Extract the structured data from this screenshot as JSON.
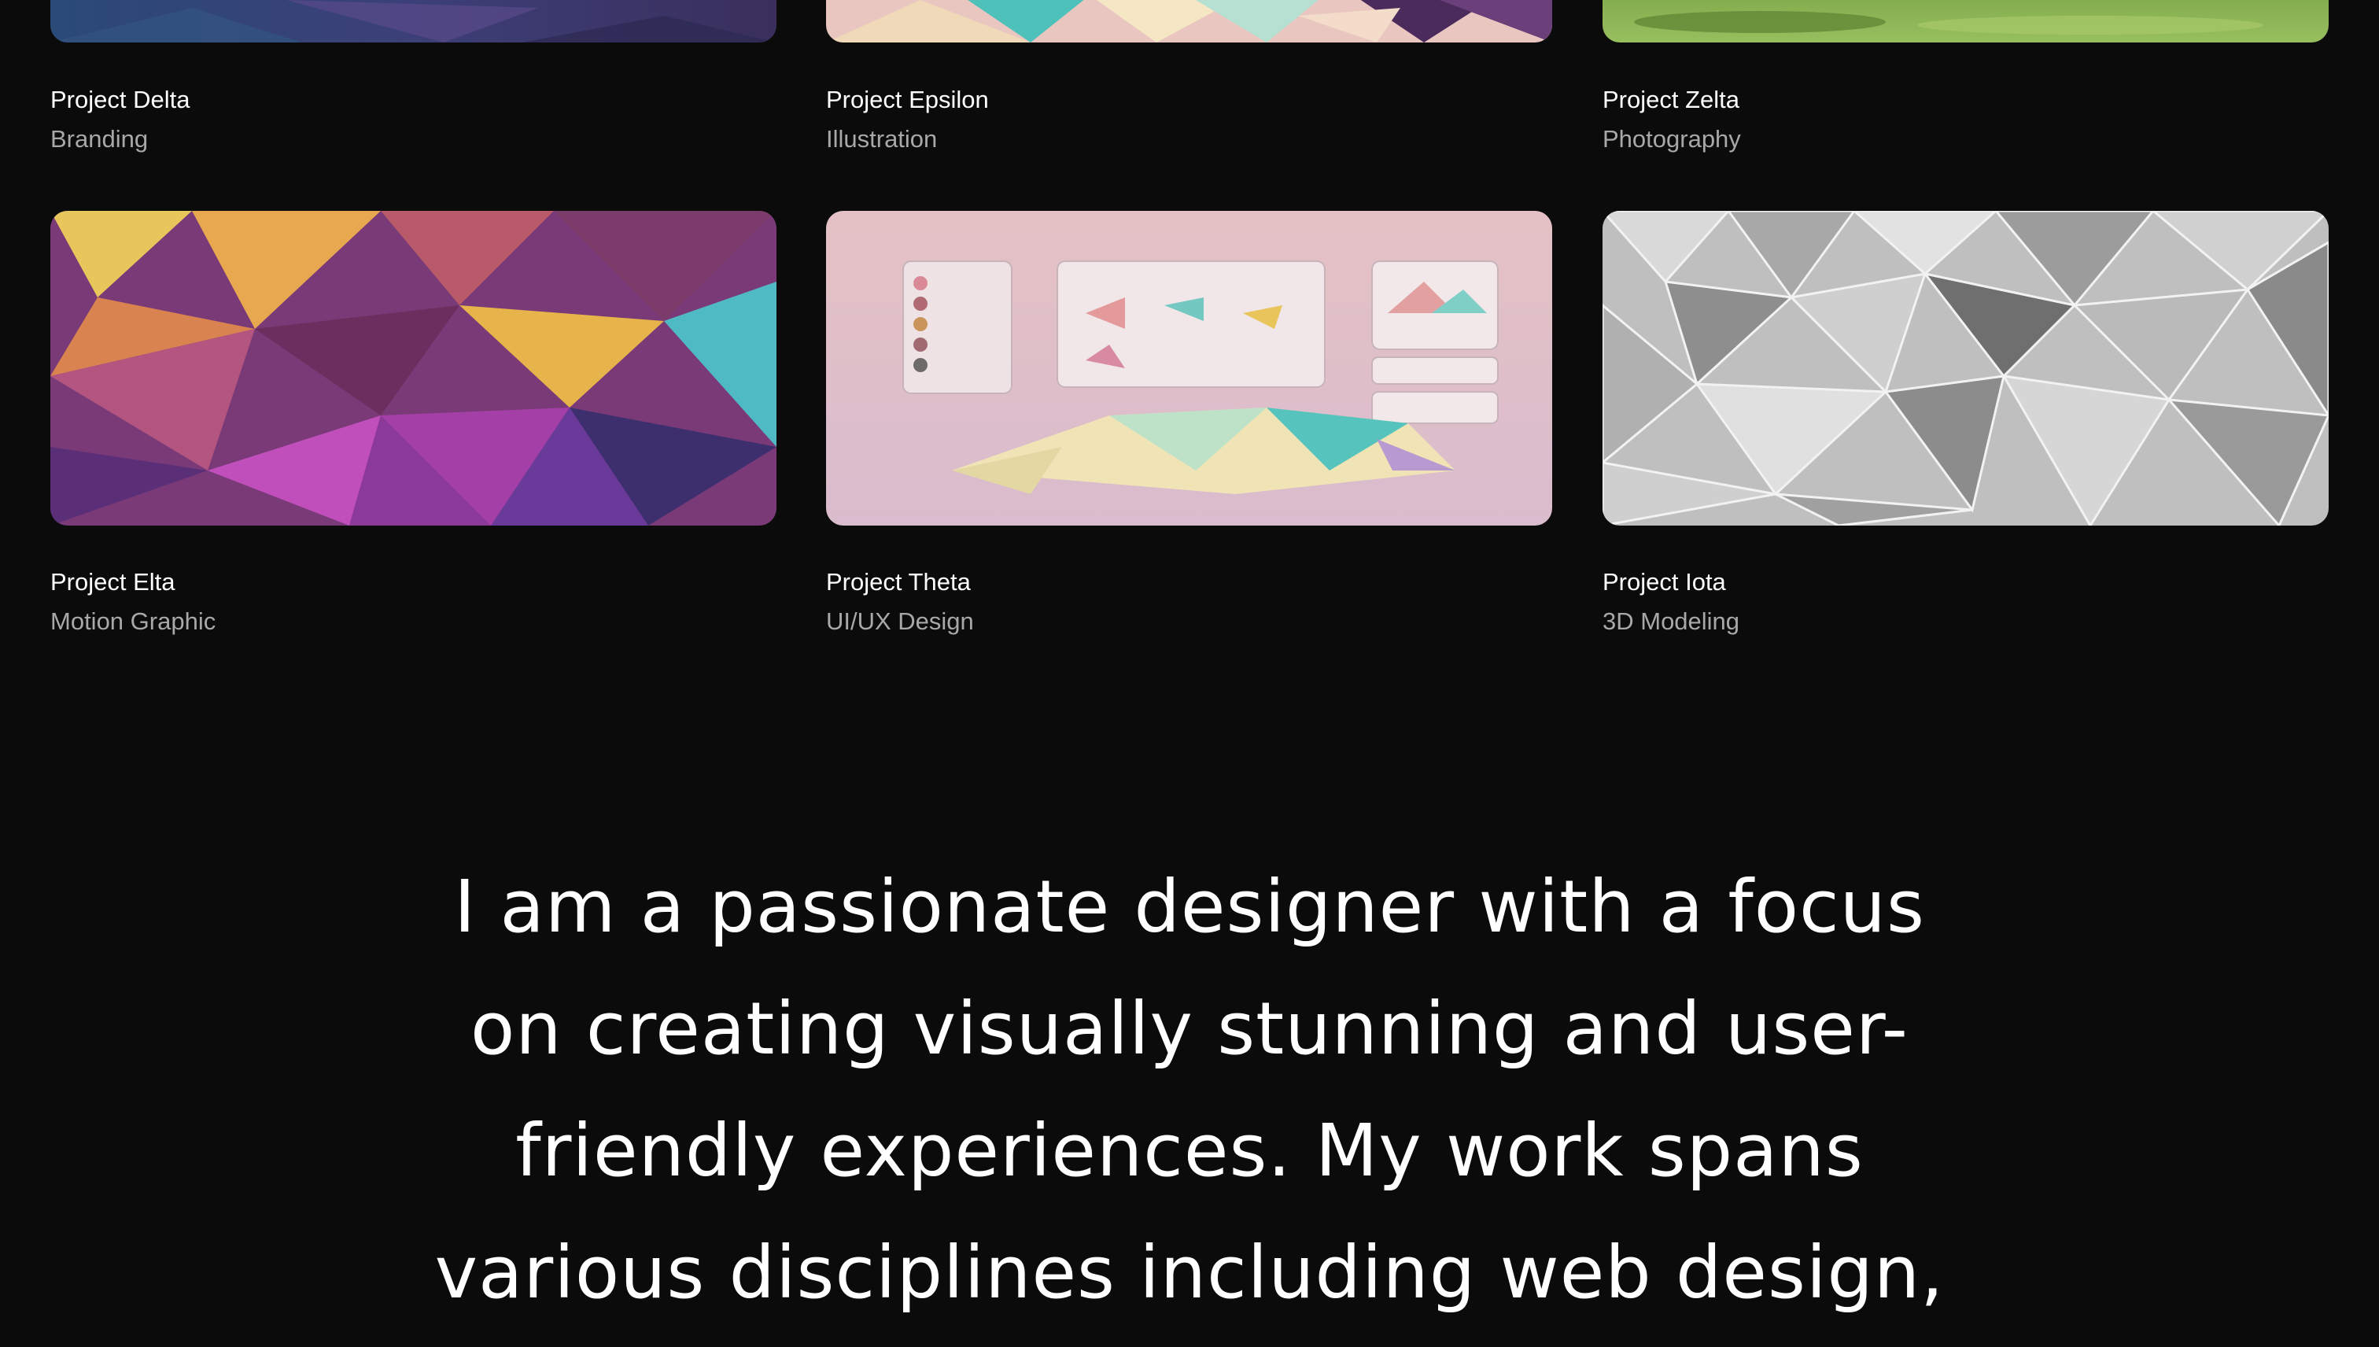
{
  "projects": [
    {
      "title": "Project Delta",
      "category": "Branding",
      "thumb": "purple-blue-polygon-image"
    },
    {
      "title": "Project Epsilon",
      "category": "Illustration",
      "thumb": "pastel-polygon-image"
    },
    {
      "title": "Project Zelta",
      "category": "Photography",
      "thumb": "green-field-image"
    },
    {
      "title": "Project Elta",
      "category": "Motion Graphic",
      "thumb": "colorful-lowpoly-image"
    },
    {
      "title": "Project Theta",
      "category": "UI/UX Design",
      "thumb": "pastel-dashboard-image"
    },
    {
      "title": "Project Iota",
      "category": "3D Modeling",
      "thumb": "gray-3d-polygon-image"
    }
  ],
  "about": {
    "text": "I am a passionate designer with a focus on creating visually stunning and user-friendly experiences. My work spans various disciplines including web design,"
  },
  "colors": {
    "background": "#0b0b0b",
    "title": "#ffffff",
    "category": "#a8a8a8"
  }
}
